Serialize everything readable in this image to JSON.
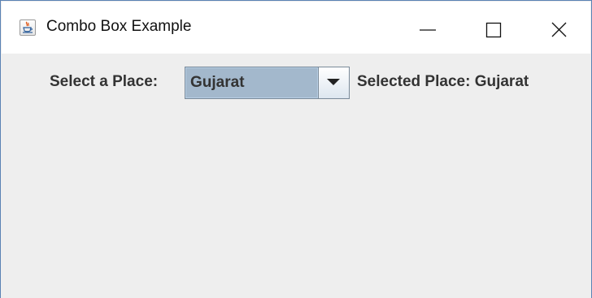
{
  "window": {
    "title": "Combo Box Example",
    "icon": "java-cup-icon",
    "controls": [
      "minimize-icon",
      "maximize-icon",
      "close-icon"
    ]
  },
  "form": {
    "select_label": "Select a Place:",
    "combo_value": "Gujarat",
    "combo_arrow_icon": "chevron-down-icon",
    "selected_text": "Selected Place: Gujarat"
  },
  "colors": {
    "title_bar": "#ffffff",
    "client_bg": "#eeeeee",
    "combo_selected_bg": "#a3b8cc",
    "window_border": "#5a82b4"
  }
}
